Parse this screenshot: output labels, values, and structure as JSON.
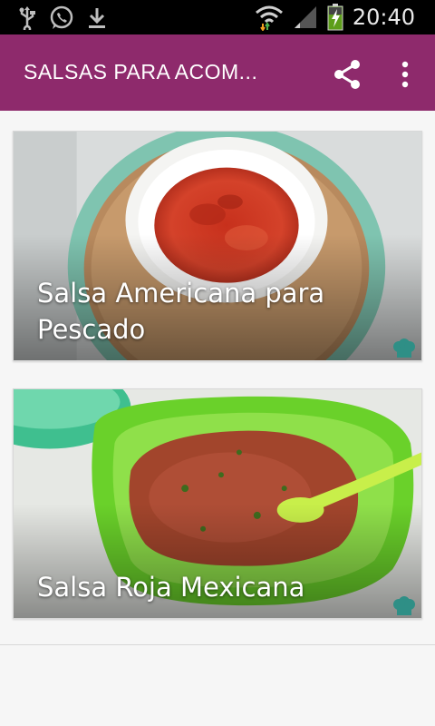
{
  "status_bar": {
    "time": "20:40",
    "icons": [
      "usb-icon",
      "whatsapp-icon",
      "download-icon",
      "wifi-icon",
      "signal-icon",
      "battery-charging-icon"
    ]
  },
  "app_bar": {
    "title": "SALSAS PARA ACOM...",
    "icons": [
      "share-icon",
      "more-vert-icon"
    ],
    "color": "#8e2a6c"
  },
  "recipes": [
    {
      "title": "Salsa Americana para Pescado"
    },
    {
      "title": "Salsa Roja Mexicana"
    }
  ]
}
